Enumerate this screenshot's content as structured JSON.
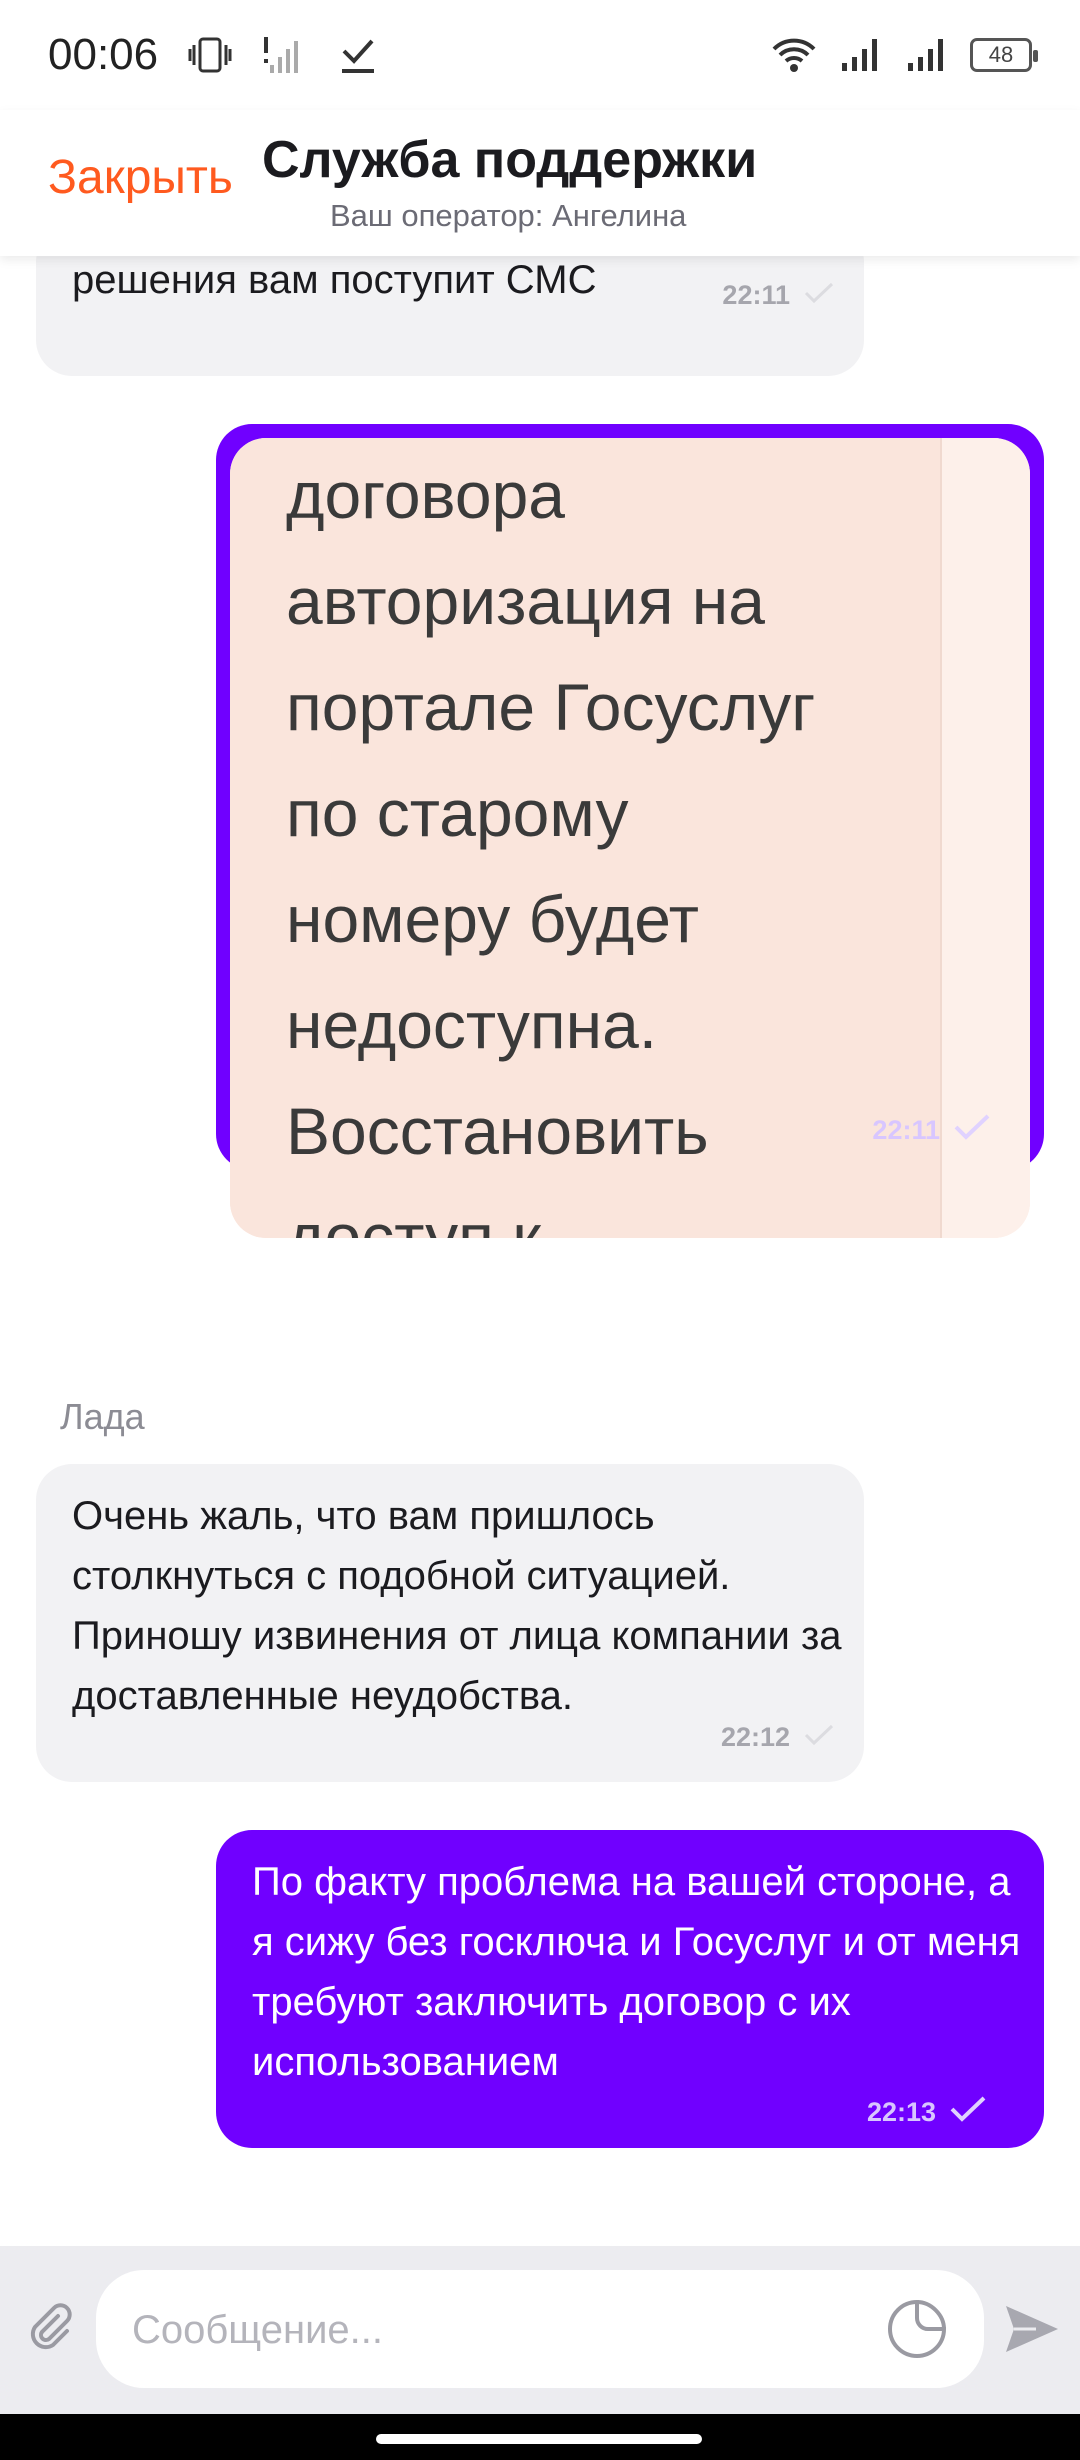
{
  "status_bar": {
    "time": "00:06",
    "battery": "48",
    "icons": [
      "vibrate-icon",
      "no-signal-icon",
      "checkmark-icon",
      "wifi-icon",
      "signal-icon",
      "signal-icon",
      "battery-icon"
    ]
  },
  "header": {
    "close_label": "Закрыть",
    "title": "Служба поддержки",
    "subtitle": "Ваш оператор: Ангелина"
  },
  "messages": [
    {
      "direction": "incoming",
      "text": "решения вам поступит СМС",
      "time": "22:11"
    },
    {
      "direction": "outgoing",
      "type": "image",
      "image_text": "договора\nавторизация на\nпортале Госуслуг\nпо старому\nномеру будет\nнедоступна.\nВосстановить\nдоступ к",
      "time": "22:11"
    },
    {
      "direction": "incoming",
      "sender": "Лада",
      "text": "Очень жаль, что вам пришлось столкнуться с подобной ситуацией. Приношу извинения от лица компании за доставленные неудобства.",
      "time": "22:12"
    },
    {
      "direction": "outgoing",
      "text": "По факту проблема на вашей стороне, а я сижу без госключа и Госуслуг и от меня требуют заключить договор с их использованием",
      "time": "22:13"
    }
  ],
  "composer": {
    "placeholder": "Сообщение..."
  },
  "colors": {
    "accent_orange": "#ff5a1f",
    "outgoing_bubble": "#7000ff",
    "incoming_bubble": "#f2f2f4"
  }
}
